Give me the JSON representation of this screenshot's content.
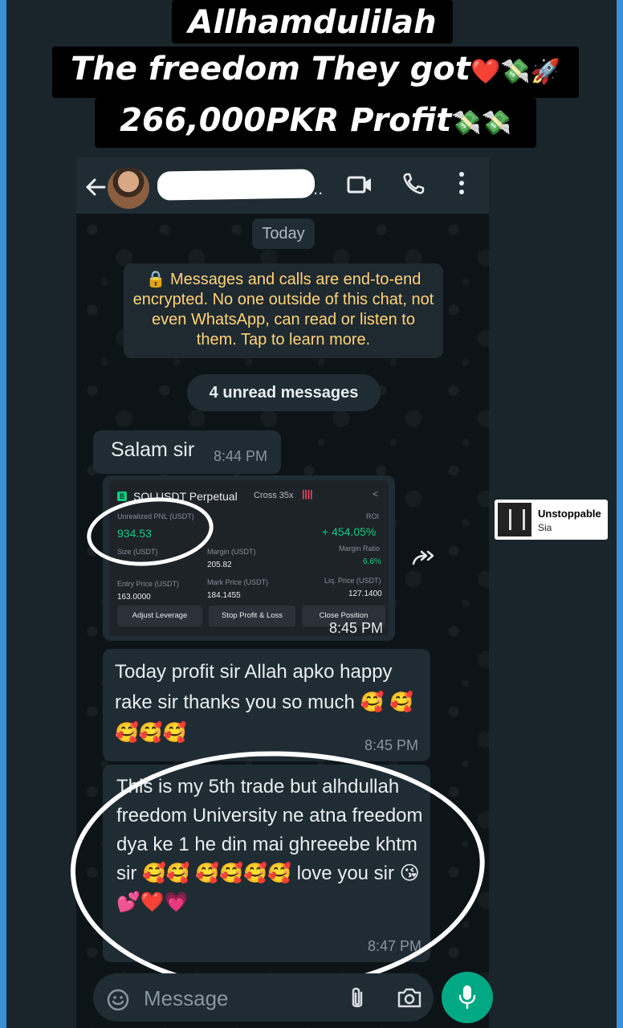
{
  "caption": {
    "line1": "Allhamdulilah",
    "line2": "The freedom They got",
    "line2_emoji": "❤️💸🚀",
    "line3": "266,000PKR Profit",
    "line3_emoji": "💸💸"
  },
  "header": {
    "name_suffix": "..",
    "icons": [
      "back-arrow-icon",
      "video-call-icon",
      "phone-call-icon",
      "more-vert-icon"
    ]
  },
  "chat": {
    "date_chip": "Today",
    "encryption_notice": "🔒 Messages and calls are end-to-end encrypted. No one outside of this chat, not even WhatsApp, can read or listen to them. Tap to learn more.",
    "unread_banner": "4 unread messages",
    "messages": [
      {
        "text": "Salam sir",
        "time": "8:44 PM"
      },
      {
        "type": "image",
        "time": "8:45 PM"
      },
      {
        "text": "Today profit sir Allah apko happy rake sir thanks you so much 🥰 🥰🥰🥰🥰",
        "time": "8:45 PM"
      },
      {
        "text": "This is my 5th trade but alhdullah freedom University  ne atna freedom dya ke 1 he din mai ghreeebe khtm sir 🥰🥰 🥰🥰🥰🥰 love you sir 😘 💕❤️💗",
        "time": "8:47 PM"
      }
    ]
  },
  "trade_card": {
    "symbol": "SOLUSDT Perpetual",
    "margin_mode": "Cross 35x",
    "bars": "||||",
    "pnl_label": "Unrealized PNL (USDT)",
    "pnl_value": "934.53",
    "roi_label": "ROI",
    "roi_value": "+ 454.05%",
    "size_label": "Size (USDT)",
    "margin_label": "Margin (USDT)",
    "margin_value": "205.82",
    "margin_ratio_label": "Margin Ratio",
    "margin_ratio_value": "6.6%",
    "entry_label": "Entry Price (USDT)",
    "entry_value": "163.0000",
    "mark_label": "Mark Price (USDT)",
    "mark_value": "184.1455",
    "liq_label": "Liq. Price (USDT)",
    "liq_value": "127.1400",
    "btn_leverage": "Adjust Leverage",
    "btn_tpsl": "Stop Profit & Loss",
    "btn_close": "Close Position"
  },
  "input": {
    "placeholder": "Message"
  },
  "music_sticker": {
    "title": "Unstoppable",
    "artist": "Sia"
  }
}
